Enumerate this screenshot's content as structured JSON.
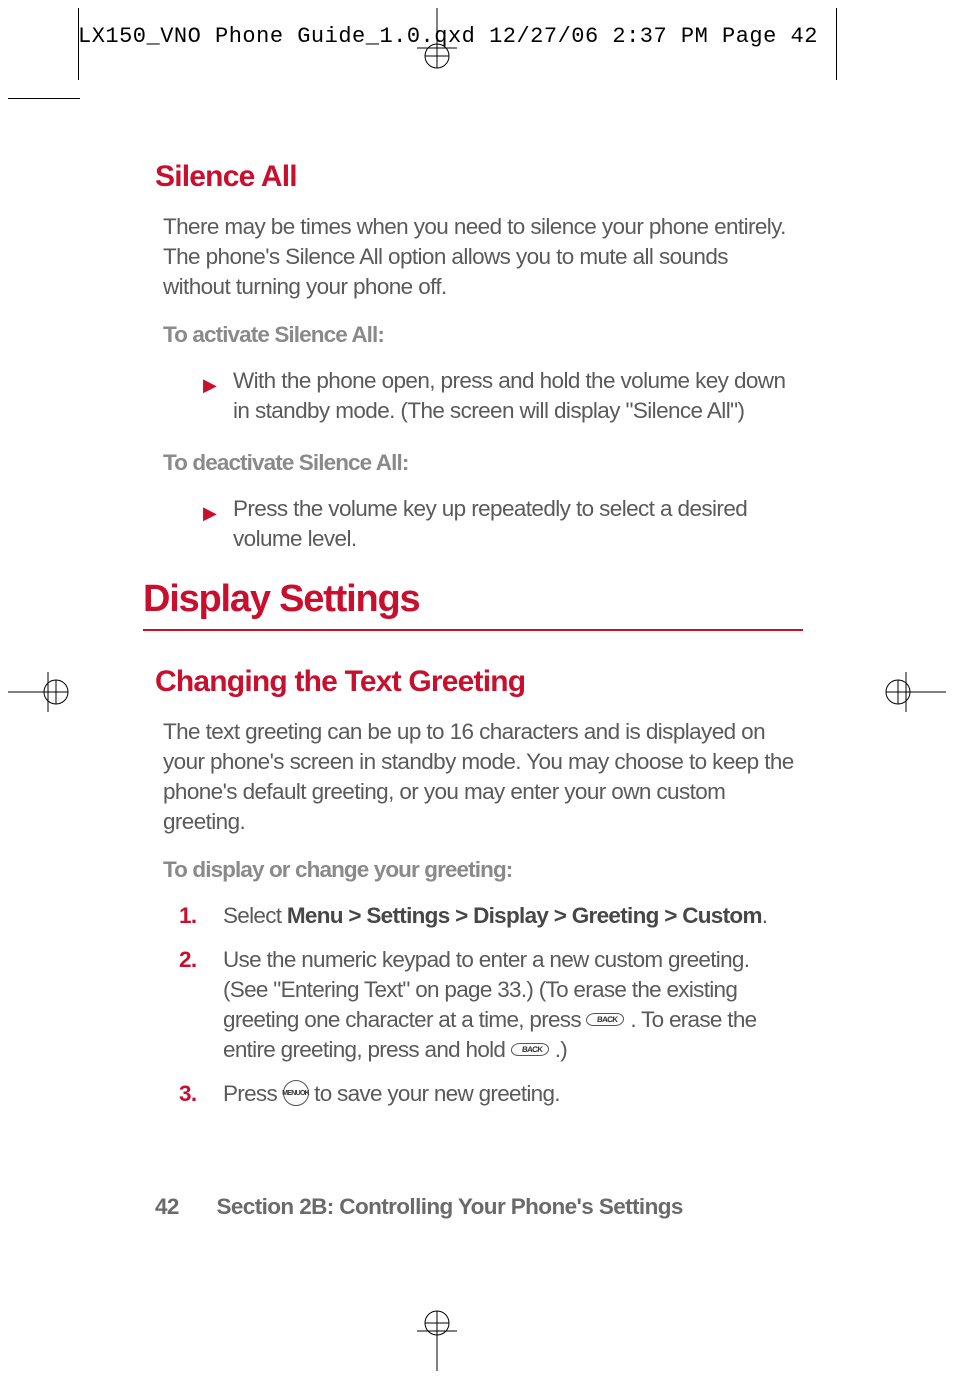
{
  "crop": {
    "header": "LX150_VNO Phone Guide_1.0.qxd  12/27/06  2:37 PM  Page 42"
  },
  "section1": {
    "heading": "Silence All",
    "intro": "There may be times when you need to silence your phone entirely. The phone's Silence All option allows you to mute all sounds without turning your phone off.",
    "activate_label": "To activate Silence All:",
    "activate_bullet": "With the phone open, press and hold the volume key down in standby mode. (The screen will display \"Silence All\")",
    "deactivate_label": "To deactivate Silence All:",
    "deactivate_bullet": "Press the volume key up repeatedly to select a desired volume level."
  },
  "main_heading": "Display Settings",
  "section2": {
    "heading": "Changing the Text Greeting",
    "intro": "The text greeting can be up to 16 characters and is displayed on your phone's screen in standby mode. You may choose to keep the phone's default greeting, or you may enter your own custom greeting.",
    "howto_label": "To display or change your greeting:",
    "step1_pre": "Select ",
    "step1_bold": "Menu > Settings > Display > Greeting > Custom",
    "step1_post": ".",
    "step2_a": "Use the numeric keypad to enter a new custom greeting. (See \"Entering Text\" on page 33.) (To erase the existing greeting one character at a time, press ",
    "step2_b": " . To erase the entire greeting, press and hold ",
    "step2_c": " .)",
    "step3_a": "Press ",
    "step3_b": " to save your new greeting."
  },
  "keys": {
    "back": "BACK",
    "ok_top": "MENU",
    "ok_bottom": "OK"
  },
  "footer": {
    "page": "42",
    "section": "Section 2B: Controlling Your Phone's Settings"
  },
  "nums": {
    "n1": "1.",
    "n2": "2.",
    "n3": "3."
  },
  "arrow": "▶"
}
